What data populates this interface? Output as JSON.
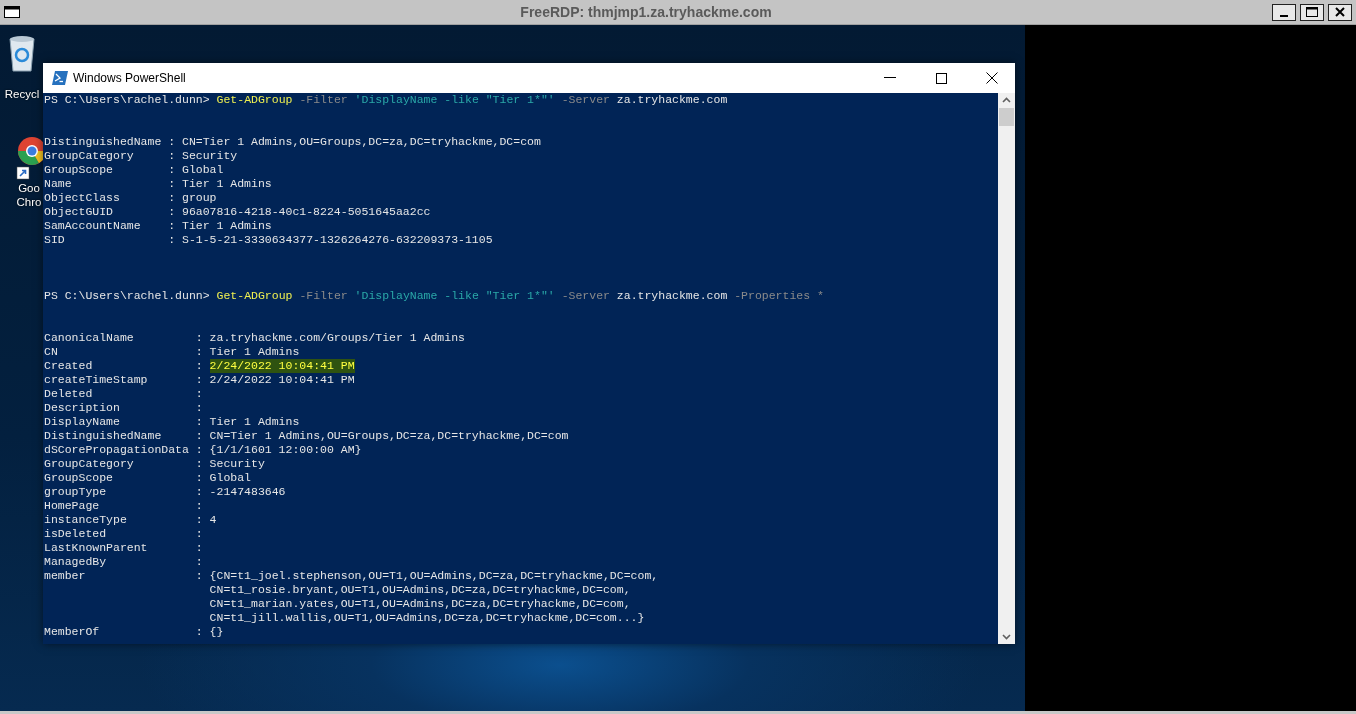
{
  "rdp_window": {
    "title": "FreeRDP: thmjmp1.za.tryhackme.com"
  },
  "desktop_icons": [
    {
      "kind": "recycle-bin",
      "label_lines": [
        "Recycl"
      ]
    },
    {
      "kind": "browser",
      "label_lines": [
        "Goo",
        "Chro"
      ]
    }
  ],
  "powershell": {
    "title": "Windows PowerShell",
    "console": [
      {
        "kind": "command",
        "prompt": "PS C:\\Users\\rachel.dunn>",
        "tokens": [
          {
            "kind": "cmdlet",
            "text": "Get-ADGroup"
          },
          {
            "kind": "parameter",
            "text": "-Filter"
          },
          {
            "kind": "string",
            "text": "'DisplayName -like \"Tier 1*\"'"
          },
          {
            "kind": "parameter",
            "text": "-Server"
          },
          {
            "kind": "argument",
            "text": "za.tryhackme.com"
          }
        ]
      },
      {
        "kind": "output",
        "separator": ":",
        "properties": [
          {
            "name": "DistinguishedName",
            "value": "CN=Tier 1 Admins,OU=Groups,DC=za,DC=tryhackme,DC=com"
          },
          {
            "name": "GroupCategory",
            "value": "Security"
          },
          {
            "name": "GroupScope",
            "value": "Global"
          },
          {
            "name": "Name",
            "value": "Tier 1 Admins"
          },
          {
            "name": "ObjectClass",
            "value": "group"
          },
          {
            "name": "ObjectGUID",
            "value": "96a07816-4218-40c1-8224-5051645aa2cc"
          },
          {
            "name": "SamAccountName",
            "value": "Tier 1 Admins"
          },
          {
            "name": "SID",
            "value": "S-1-5-21-3330634377-1326264276-632209373-1105"
          }
        ]
      },
      {
        "kind": "command",
        "prompt": "PS C:\\Users\\rachel.dunn>",
        "tokens": [
          {
            "kind": "cmdlet",
            "text": "Get-ADGroup"
          },
          {
            "kind": "parameter",
            "text": "-Filter"
          },
          {
            "kind": "string",
            "text": "'DisplayName -like \"Tier 1*\"'"
          },
          {
            "kind": "parameter",
            "text": "-Server"
          },
          {
            "kind": "argument",
            "text": "za.tryhackme.com"
          },
          {
            "kind": "parameter",
            "text": "-Properties"
          },
          {
            "kind": "parameter",
            "text": "*"
          }
        ]
      },
      {
        "kind": "output",
        "separator": ":",
        "properties": [
          {
            "name": "CanonicalName",
            "value": "za.tryhackme.com/Groups/Tier 1 Admins"
          },
          {
            "name": "CN",
            "value": "Tier 1 Admins"
          },
          {
            "name": "Created",
            "value": "2/24/2022 10:04:41 PM",
            "highlighted": true
          },
          {
            "name": "createTimeStamp",
            "value": "2/24/2022 10:04:41 PM"
          },
          {
            "name": "Deleted"
          },
          {
            "name": "Description"
          },
          {
            "name": "DisplayName",
            "value": "Tier 1 Admins"
          },
          {
            "name": "DistinguishedName",
            "value": "CN=Tier 1 Admins,OU=Groups,DC=za,DC=tryhackme,DC=com"
          },
          {
            "name": "dSCorePropagationData",
            "value": "{1/1/1601 12:00:00 AM}"
          },
          {
            "name": "GroupCategory",
            "value": "Security"
          },
          {
            "name": "GroupScope",
            "value": "Global"
          },
          {
            "name": "groupType",
            "value": "-2147483646"
          },
          {
            "name": "HomePage"
          },
          {
            "name": "instanceType",
            "value": "4"
          },
          {
            "name": "isDeleted"
          },
          {
            "name": "LastKnownParent"
          },
          {
            "name": "ManagedBy"
          },
          {
            "name": "member",
            "value": "{CN=t1_joel.stephenson,OU=T1,OU=Admins,DC=za,DC=tryhackme,DC=com,",
            "more": [
              "CN=t1_rosie.bryant,OU=T1,OU=Admins,DC=za,DC=tryhackme,DC=com,",
              "CN=t1_marian.yates,OU=T1,OU=Admins,DC=za,DC=tryhackme,DC=com,",
              "CN=t1_jill.wallis,OU=T1,OU=Admins,DC=za,DC=tryhackme,DC=com...}"
            ]
          },
          {
            "name": "MemberOf",
            "value": "{}"
          }
        ]
      }
    ]
  }
}
